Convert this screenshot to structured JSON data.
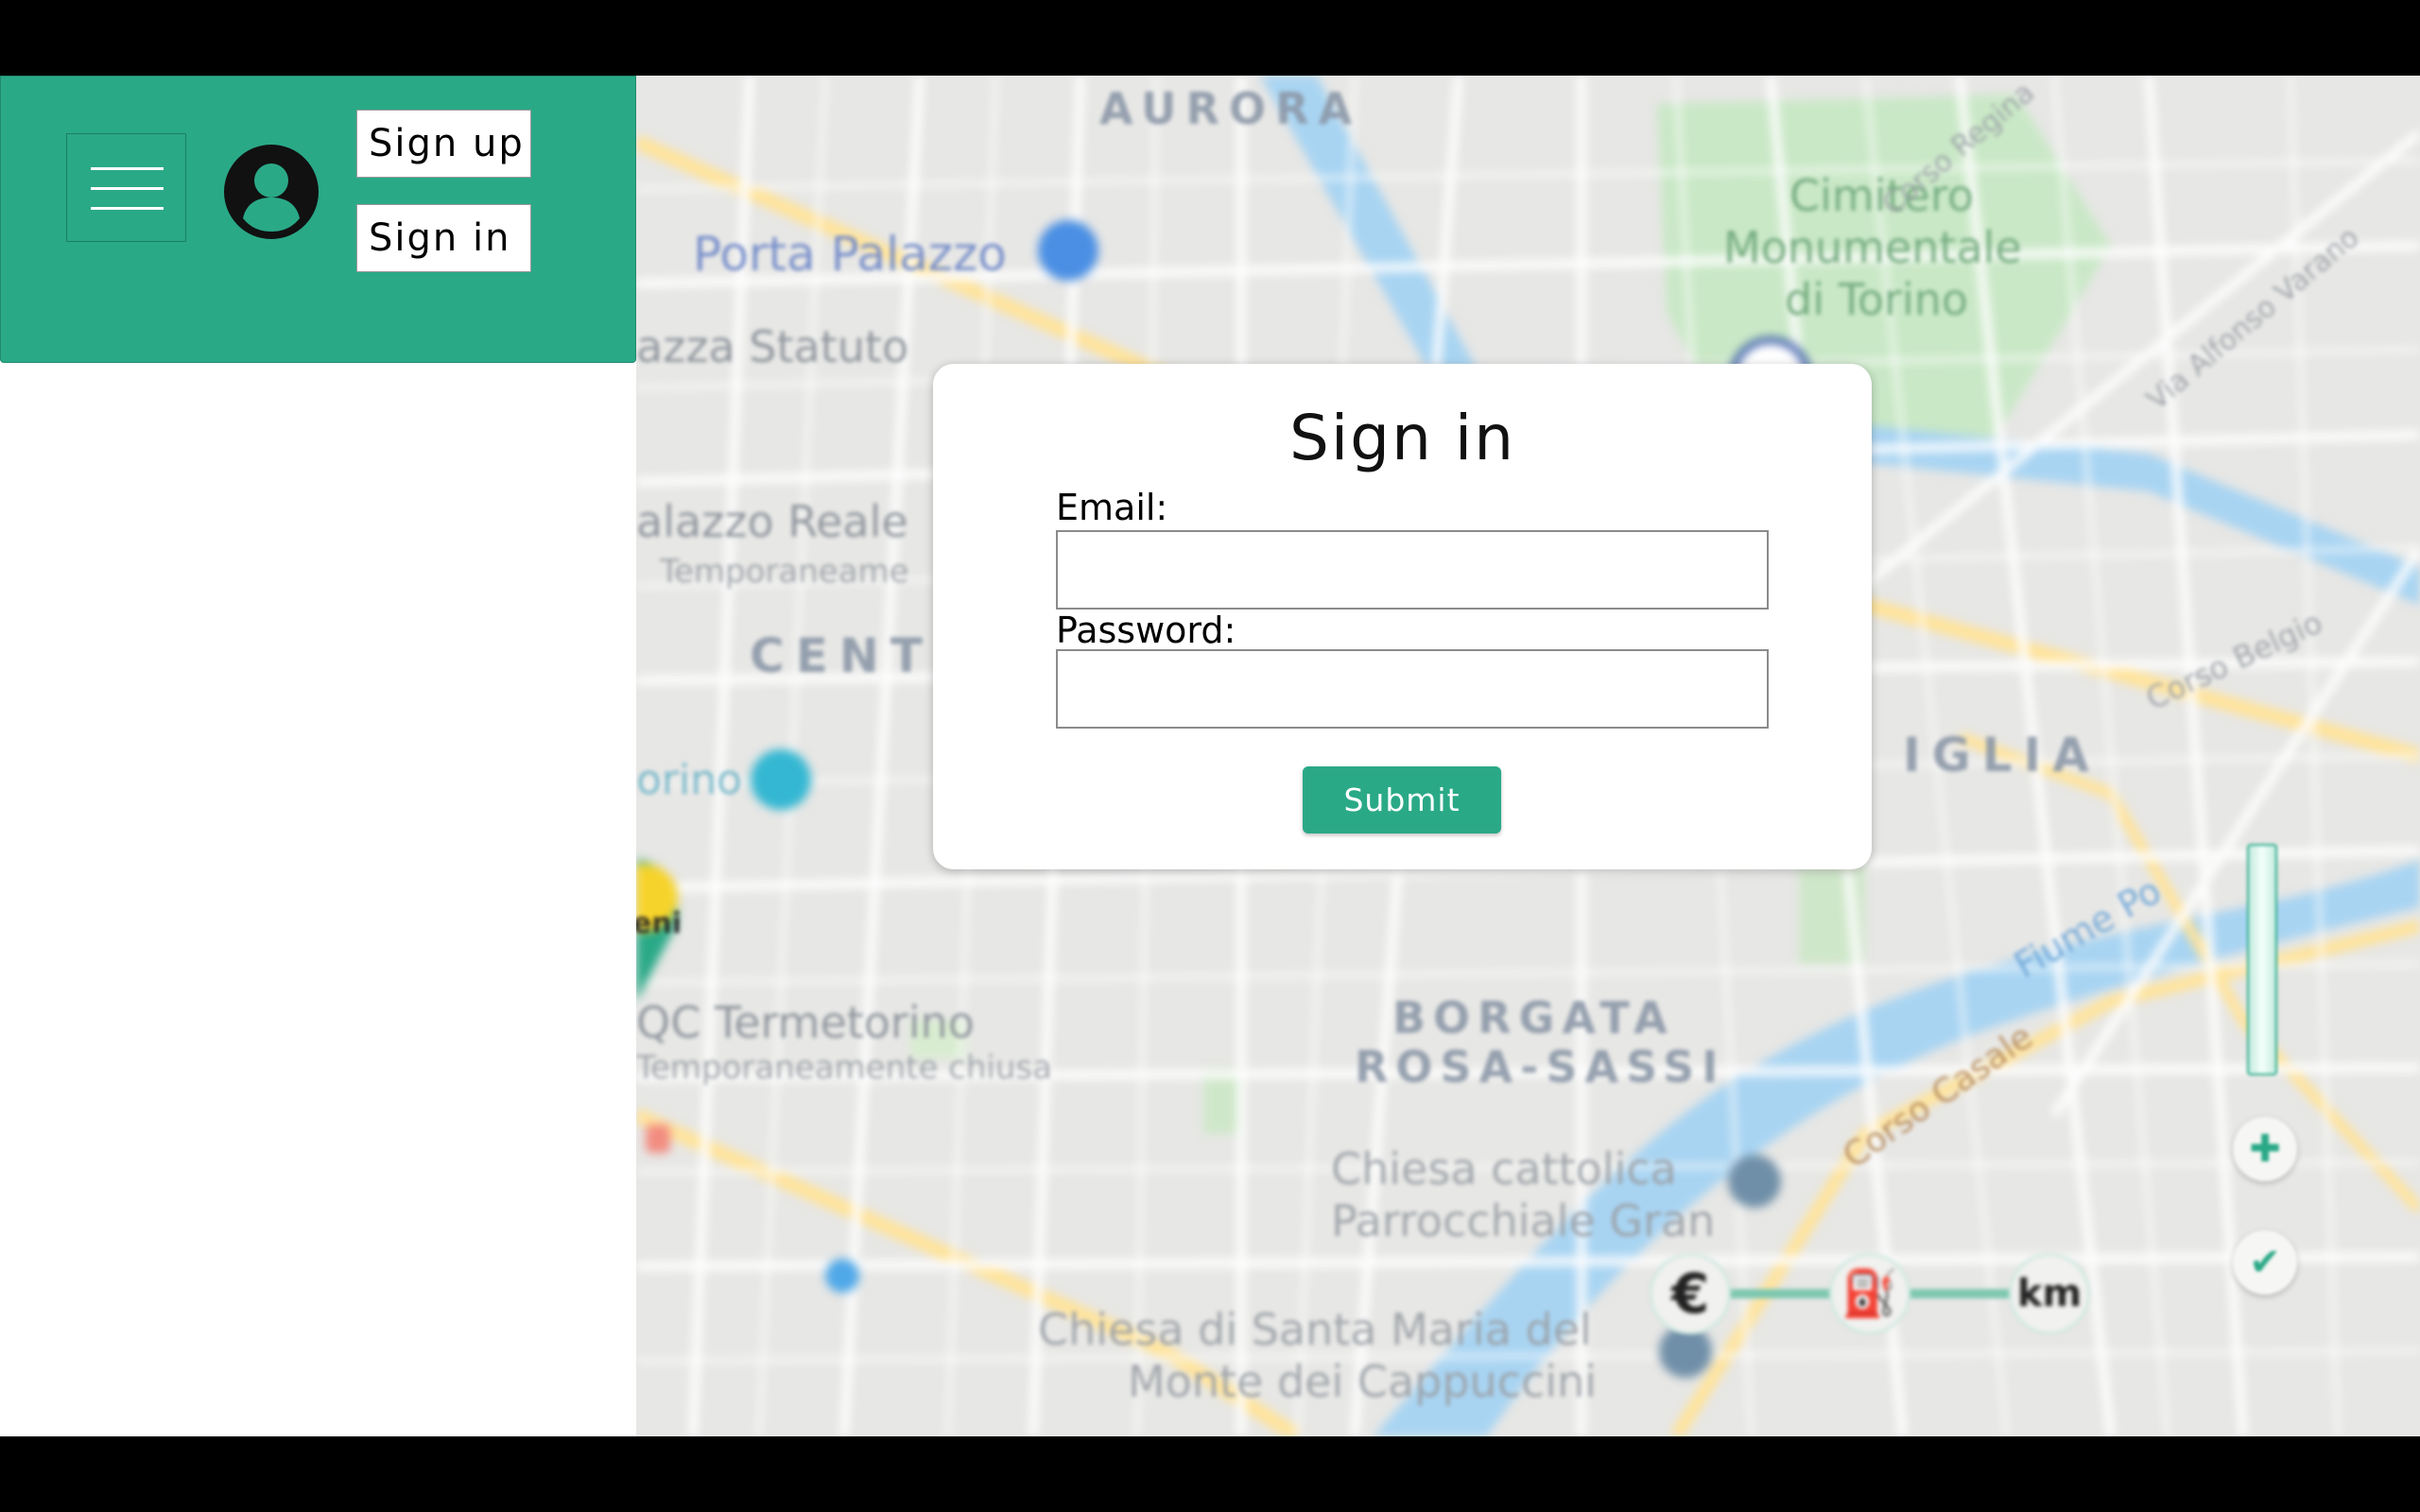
{
  "header": {
    "menu_icon": "hamburger-menu-icon",
    "avatar_icon": "user-avatar-icon",
    "sign_up_label": "Sign up",
    "sign_in_label": "Sign in"
  },
  "modal": {
    "title": "Sign in",
    "email_label": "Email:",
    "email_value": "",
    "password_label": "Password:",
    "password_value": "",
    "submit_label": "Submit"
  },
  "map": {
    "labels": {
      "aurora": "AURORA",
      "porta_palazzo": "Porta Palazzo",
      "piazza_statuto": "azza Statuto",
      "cimitero_1": "Cimitero",
      "cimitero_2": "Monumentale",
      "cimitero_3": "di Torino",
      "palazzo_reale": "alazzo Reale",
      "temporaneamente_1": "Temporaneame",
      "centro": "CENTR",
      "vanchiglia": "IGLIA",
      "torino": "orino",
      "termetorino": "QC Termetorino",
      "temporaneamente_2": "Temporaneamente chiusa",
      "borgata_1": "BORGATA",
      "borgata_2": "ROSA-SASSI",
      "chiesa_cattolica_1": "Chiesa cattolica",
      "chiesa_cattolica_2": "Parrocchiale Gran",
      "chiesa_santa_1": "Chiesa di Santa Maria del",
      "chiesa_santa_2": "Monte dei Cappuccini",
      "corso_casale": "Corso Casale",
      "fiume_po": "Fiume Po",
      "corso_belgio": "Corso Belgio",
      "via_alfonso": "Via Alfonso Varano",
      "corso_regina": "Corso Regina",
      "eni": "eni"
    },
    "filters": {
      "price": "€",
      "power": "⛽",
      "distance": "km"
    },
    "colors": {
      "accent": "#2aa987",
      "water": "#a8d4f2",
      "park": "#c9e8c6",
      "road_major": "#ffe39a"
    }
  }
}
